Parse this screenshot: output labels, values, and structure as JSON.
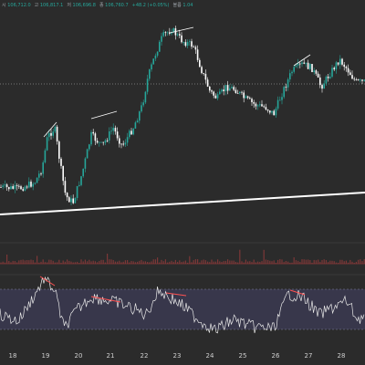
{
  "header": {
    "items": [
      {
        "key": "시",
        "value": "106,712.0"
      },
      {
        "key": "고",
        "value": "106,817.1"
      },
      {
        "key": "저",
        "value": "106,696.8"
      },
      {
        "key": "종",
        "value": "106,760.7"
      },
      {
        "key": "",
        "value": "+48.2 (+0.05%)"
      },
      {
        "key": "볼륨",
        "value": "1.04"
      }
    ]
  },
  "x_axis": {
    "ticks": [
      "18",
      "19",
      "20",
      "21",
      "22",
      "23",
      "24",
      "25",
      "26",
      "27",
      "28"
    ]
  },
  "colors": {
    "background": "#2b2b2b",
    "candle_up": "#26a69a",
    "candle_down": "#ffffff",
    "rsi_band": "#3f3d5a",
    "divergence_up": "#ffffff",
    "divergence_down": "#ff5252",
    "volume": "#8b3a3a"
  }
}
